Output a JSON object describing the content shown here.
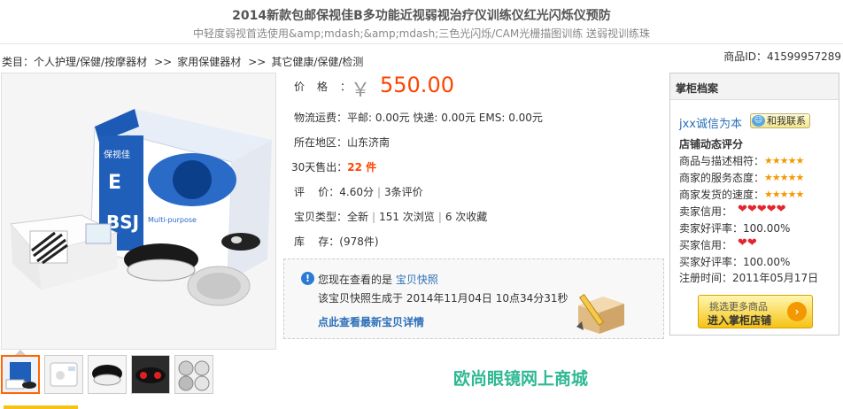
{
  "header": {
    "title": "2014新款包邮保视佳B多功能近视弱视治疗仪训练仪红光闪烁仪预防",
    "subtitle": "中轻度弱视首选使用&amp;mdash;&amp;mdash;三色光闪烁/CAM光栅描图训练 送弱视训练珠"
  },
  "breadcrumb": {
    "prefix": "类目：",
    "items": [
      "个人护理/保健/按摩器材",
      "家用保健器材",
      "其它健康/保健/检测"
    ],
    "separator": ">>"
  },
  "item_id": "商品ID：41599957289",
  "product": {
    "price_label": "价格：",
    "currency": "￥",
    "price": "550.00",
    "shipping_label": "物流运费：",
    "shipping_value": "平邮: 0.00元   快递: 0.00元   EMS: 0.00元",
    "location_label": "所在地区：",
    "location_value": "山东济南",
    "sold_label": "30天售出：",
    "sold_value": "22 件",
    "rating_label": "评    价：",
    "rating_score": "4.60分",
    "rating_count": "3条评价",
    "type_label": "宝贝类型：",
    "type_condition": "全新",
    "views": "151 次浏览",
    "favorites": "6 次收藏",
    "stock_label": "库    存：",
    "stock_value": "(978件)"
  },
  "snapshot": {
    "text_prefix": "您现在查看的是 ",
    "link_text": "宝贝快照",
    "generated": "该宝贝快照生成于 2014年11月04日 10点34分31秒",
    "latest_link": "点此查看最新宝贝详情"
  },
  "shop": {
    "header": "掌柜档案",
    "seller_name": "jxx诚信为本",
    "contact_label": "和我联系",
    "rating_title": "店铺动态评分",
    "ratings": [
      {
        "label": "商品与描述相符：",
        "stars": "★★★★★"
      },
      {
        "label": "商家的服务态度：",
        "stars": "★★★★★"
      },
      {
        "label": "商家发货的速度：",
        "stars": "★★★★★"
      }
    ],
    "seller_credit_label": "卖家信用：",
    "seller_hearts": "❤❤❤❤❤",
    "seller_positive": "卖家好评率：100.00%",
    "buyer_credit_label": "买家信用：",
    "buyer_hearts": "❤❤",
    "buyer_positive": "买家好评率：100.00%",
    "registered": "注册时间：2011年05月17日",
    "enter_line1": "挑选更多商品",
    "enter_line2": "进入掌柜店铺",
    "enter_arrow": "›"
  },
  "store_link": "欧尚眼镜网上商城",
  "colors": {
    "price": "#ff4400",
    "link": "#2b6fb8",
    "store_link": "#2fb893",
    "active_thumb": "#ff6600"
  }
}
